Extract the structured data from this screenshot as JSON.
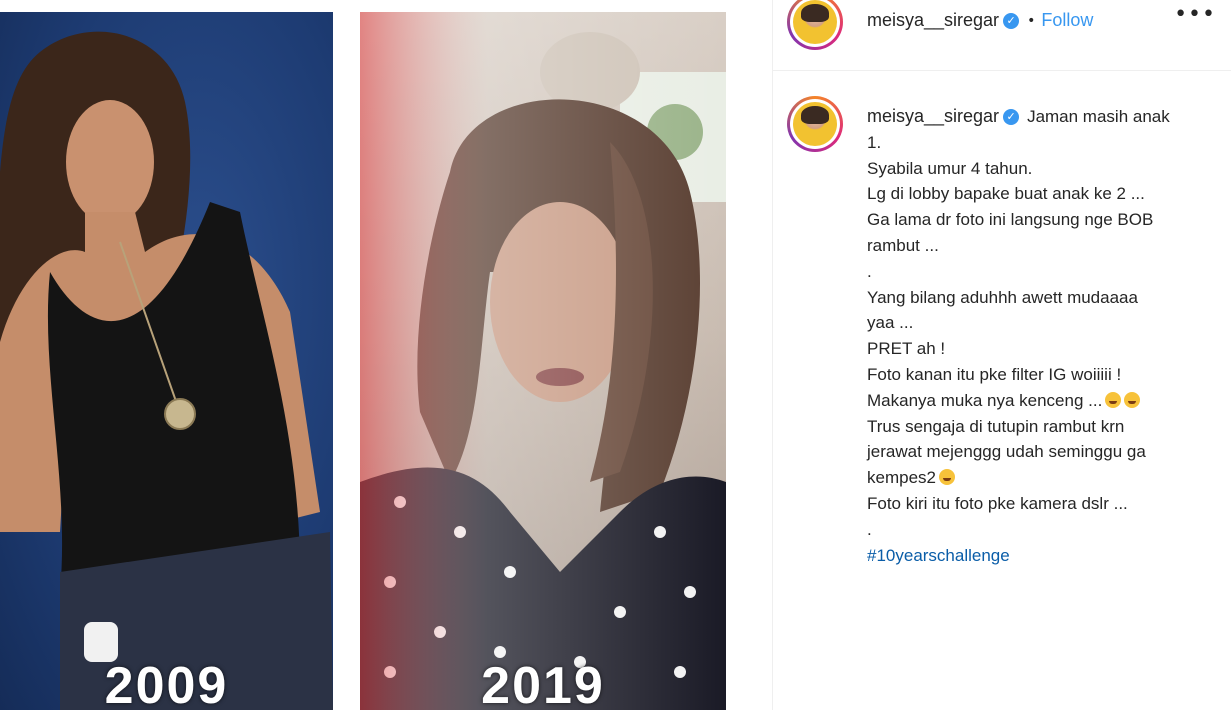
{
  "photos": {
    "left": {
      "year": "2009"
    },
    "right": {
      "year": "2019"
    }
  },
  "post": {
    "header": {
      "username": "meisya__siregar",
      "verified_icon": "verified-badge-icon",
      "separator": "•",
      "follow_label": "Follow",
      "more_label": "•••"
    },
    "caption": {
      "username": "meisya__siregar",
      "first_line": "Jaman masih anak",
      "lines": [
        "1.",
        "Syabila umur 4 tahun.",
        "Lg di lobby bapake buat anak ke 2 ...",
        "Ga lama dr foto ini langsung nge BOB",
        "rambut ...",
        ".",
        "Yang bilang aduhhh awett mudaaaa",
        "yaa ...",
        "PRET ah !",
        "Foto kanan itu pke filter IG woiiiii !",
        "Makanya muka nya kenceng ...",
        "Trus sengaja di tutupin rambut krn",
        "jerawat mejenggg udah seminggu ga",
        "kempes2",
        "Foto kiri itu foto pke kamera dslr ...",
        "."
      ],
      "hashtag": "#10yearschallenge"
    },
    "colors": {
      "link_blue": "#3897f0",
      "hashtag_blue": "#0a5da8",
      "text": "#262626"
    }
  }
}
